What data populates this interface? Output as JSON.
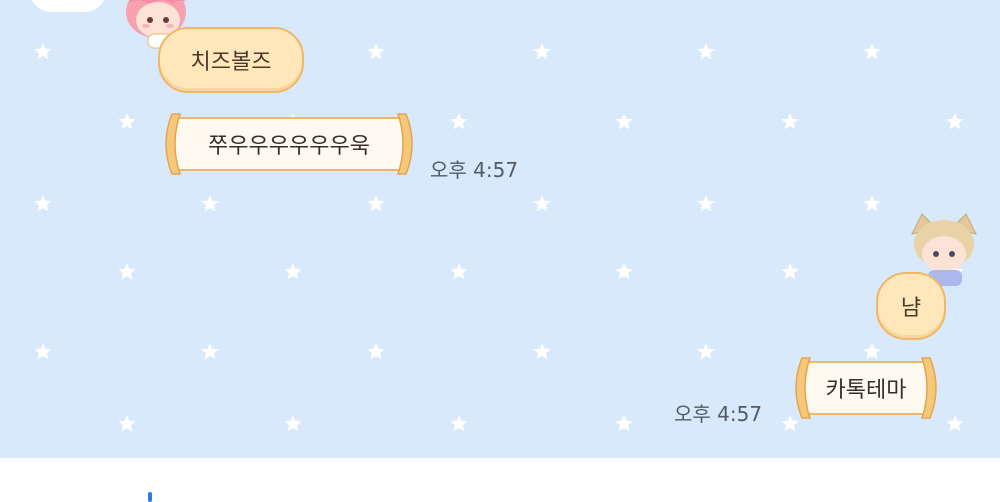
{
  "messages": [
    {
      "sender": "cheese",
      "text": "치즈볼즈"
    },
    {
      "sender": "cheese",
      "text": "쭈우우우우우우욱",
      "time": "오후 4:57"
    },
    {
      "sender": "me",
      "text": "냠"
    },
    {
      "sender": "me",
      "text": "카톡테마",
      "time": "오후 4:57"
    }
  ],
  "colors": {
    "background": "#d8e9fb",
    "bubble_fill": "#fde7bb",
    "bubble_border": "#f1b768",
    "scroll_paper": "#fffaf0",
    "star": "#ffffff",
    "time_text": "#555a63"
  },
  "icons": [
    "pink-hair-character-avatar",
    "cat-ear-character-avatar",
    "star-pattern"
  ]
}
